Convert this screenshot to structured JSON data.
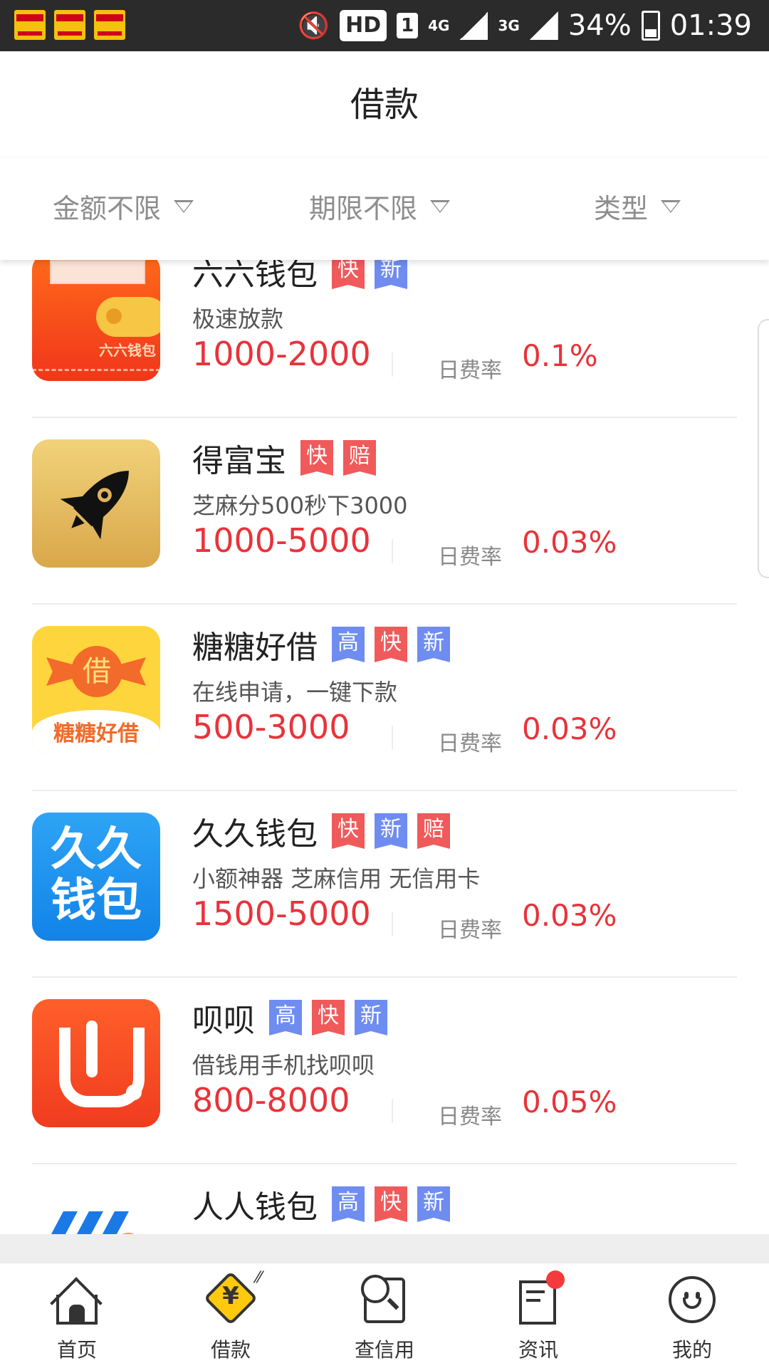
{
  "status_bar": {
    "hd": "HD",
    "sim": "1",
    "net1": "4G",
    "net2": "3G",
    "battery": "34%",
    "time": "01:39"
  },
  "header": {
    "title": "借款"
  },
  "filters": [
    {
      "label": "金额不限"
    },
    {
      "label": "期限不限"
    },
    {
      "label": "类型"
    }
  ],
  "rate_label": "日费率",
  "items": [
    {
      "name": "六六钱包",
      "tags": [
        "快",
        "新"
      ],
      "desc": "极速放款",
      "amount": "1000-2000",
      "rate": "0.1%",
      "logo_text": "六六钱包"
    },
    {
      "name": "得富宝",
      "tags": [
        "快",
        "赔"
      ],
      "desc": "芝麻分500秒下3000",
      "amount": "1000-5000",
      "rate": "0.03%"
    },
    {
      "name": "糖糖好借",
      "tags": [
        "高",
        "快",
        "新"
      ],
      "desc": "在线申请，一键下款",
      "amount": "500-3000",
      "rate": "0.03%",
      "logo_text": "糖糖好借",
      "logo_char": "借"
    },
    {
      "name": "久久钱包",
      "tags": [
        "快",
        "新",
        "赔"
      ],
      "desc": "小额神器 芝麻信用 无信用卡",
      "amount": "1500-5000",
      "rate": "0.03%",
      "logo_text": "久久钱包"
    },
    {
      "name": "呗呗",
      "tags": [
        "高",
        "快",
        "新"
      ],
      "desc": "借钱用手机找呗呗",
      "amount": "800-8000",
      "rate": "0.05%"
    },
    {
      "name": "人人钱包",
      "tags": [
        "高",
        "快",
        "新"
      ]
    }
  ],
  "tag_colors": {
    "高": "#6f8cf0",
    "快": "#f05a5a",
    "新": "#6f8cf0",
    "赔": "#f05a5a"
  },
  "accent_color": "#e8333a",
  "nav": [
    {
      "label": "首页",
      "icon": "home-icon"
    },
    {
      "label": "借款",
      "icon": "loan-icon",
      "active": true
    },
    {
      "label": "查信用",
      "icon": "credit-search-icon"
    },
    {
      "label": "资讯",
      "icon": "news-icon",
      "badge": true
    },
    {
      "label": "我的",
      "icon": "profile-icon"
    }
  ]
}
